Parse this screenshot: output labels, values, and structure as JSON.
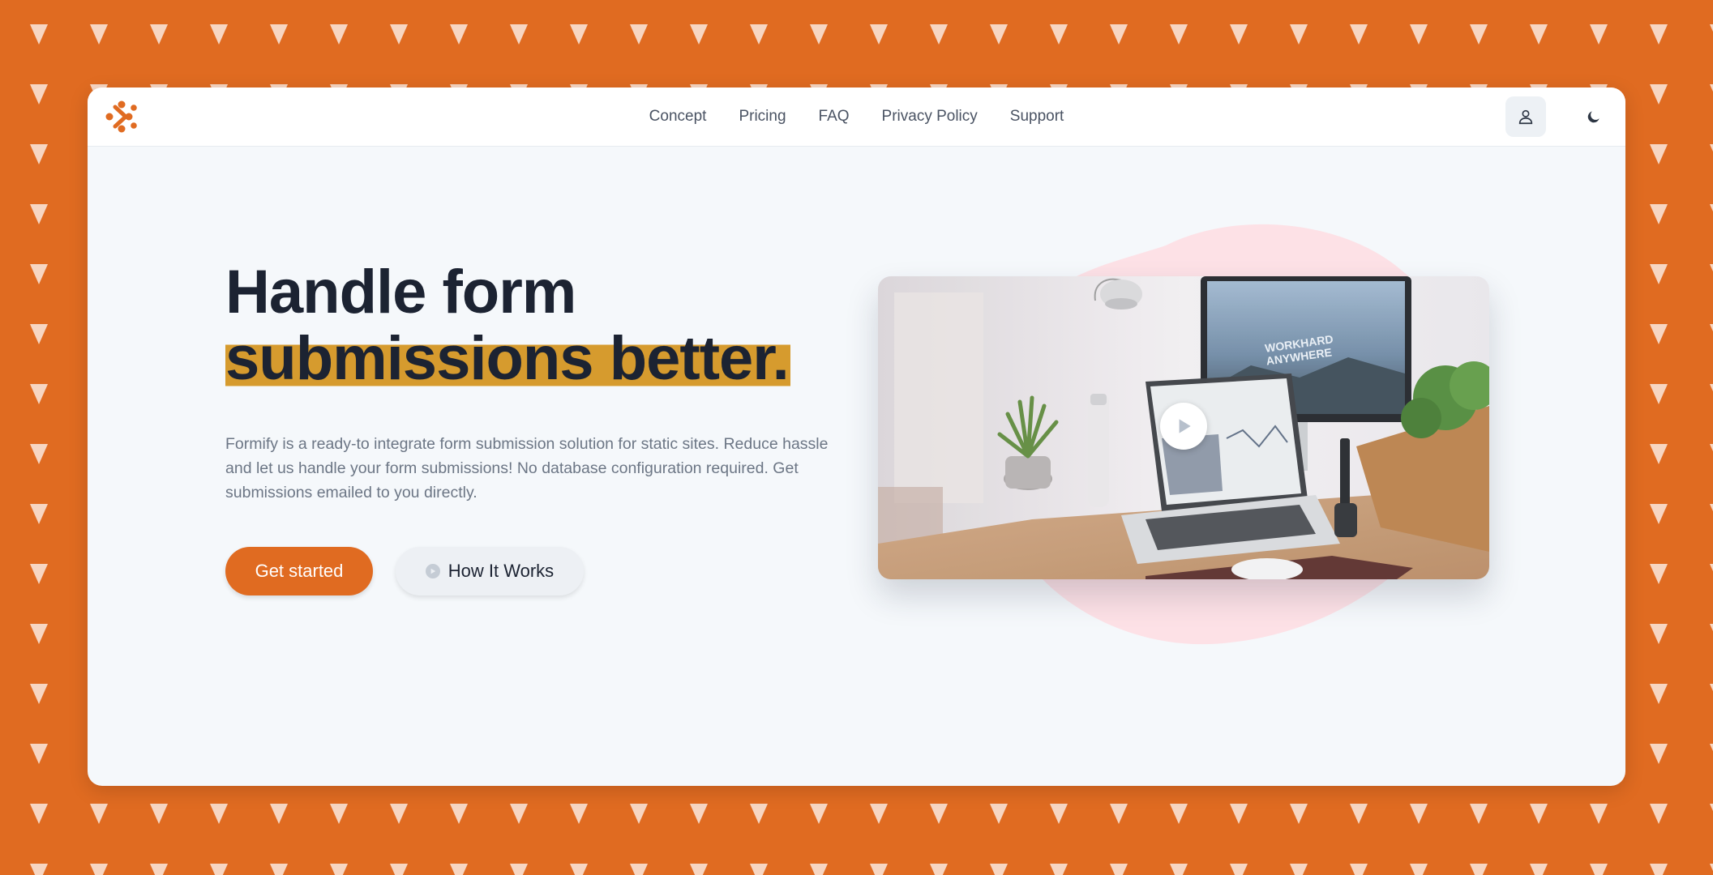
{
  "brand": {
    "logo_icon": "formify-logo-icon",
    "accent": "#e06b21"
  },
  "nav": {
    "links": [
      {
        "label": "Concept"
      },
      {
        "label": "Pricing"
      },
      {
        "label": "FAQ"
      },
      {
        "label": "Privacy Policy"
      },
      {
        "label": "Support"
      }
    ],
    "user_icon": "user-icon",
    "theme_icon": "moon-icon"
  },
  "hero": {
    "title_line1": "Handle form",
    "title_line2": "submissions better.",
    "description": "Formify is a ready-to integrate form submission solution for static sites. Reduce hassle and let us handle your form submissions! No database configuration required. Get submissions emailed to you directly.",
    "primary_button": "Get started",
    "secondary_button": "How It Works",
    "highlight_color": "#d69b2e",
    "blob_color": "#fde1e6"
  },
  "media": {
    "screen_text_line1": "WORKHARD",
    "screen_text_line2": "ANYWHERE",
    "play_icon": "play-icon"
  }
}
